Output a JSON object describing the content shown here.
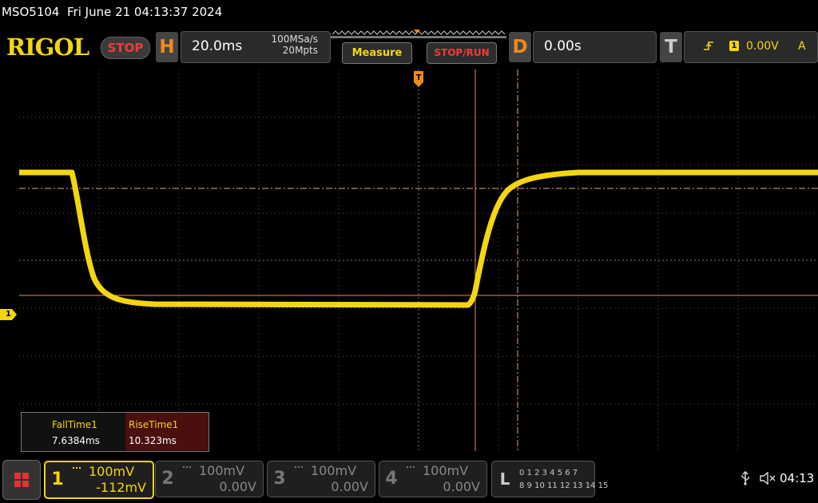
{
  "topline": {
    "model": "MSO5104",
    "datetime": "Fri June 21 04:13:37 2024"
  },
  "header": {
    "logo": "RIGOL",
    "run_state": "STOP",
    "horizontal": {
      "letter": "H",
      "timebase": "20.0ms",
      "sample_rate": "100MSa/s",
      "memory_depth": "20Mpts"
    },
    "measure_label": "Measure",
    "stoprun_label": "STOP/RUN",
    "delay": {
      "letter": "D",
      "value": "0.00s"
    },
    "trigger": {
      "letter": "T",
      "source": "1",
      "level": "0.00V",
      "mode": "A"
    }
  },
  "channel_marker": "1",
  "measurements": [
    {
      "name": "FallTime1",
      "value": "7.6384ms"
    },
    {
      "name": "RiseTime1",
      "value": "10.323ms"
    }
  ],
  "channels": [
    {
      "num": "1",
      "scale": "100mV",
      "offset": "-112mV",
      "color": "#f4d60f"
    },
    {
      "num": "2",
      "scale": "100mV",
      "offset": "0.00V",
      "color": "#888888"
    },
    {
      "num": "3",
      "scale": "100mV",
      "offset": "0.00V",
      "color": "#888888"
    },
    {
      "num": "4",
      "scale": "100mV",
      "offset": "0.00V",
      "color": "#888888"
    }
  ],
  "logic": {
    "letter": "L",
    "row1": "0 1 2 3  4 5 6 7",
    "row2": "8 9 10 11 12 13 14 15"
  },
  "status": {
    "time": "04:13"
  },
  "colors": {
    "accent": "#f4d60f",
    "orange": "#f08a1c",
    "red": "#f23b3b"
  }
}
